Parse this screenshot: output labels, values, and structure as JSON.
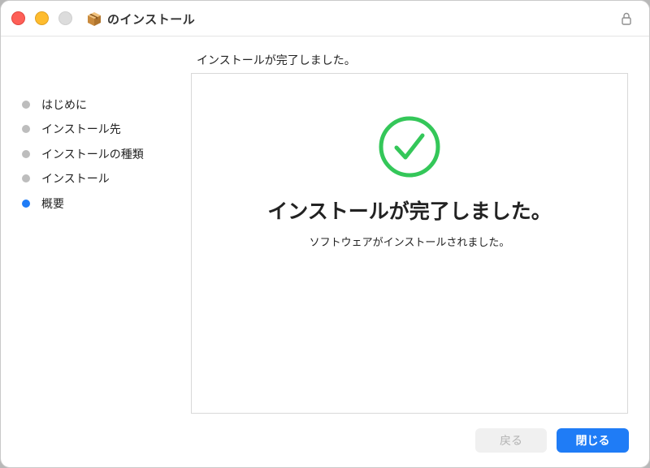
{
  "window": {
    "title": "のインストール"
  },
  "sidebar": {
    "steps": [
      {
        "label": "はじめに",
        "state": "done"
      },
      {
        "label": "インストール先",
        "state": "done"
      },
      {
        "label": "インストールの種類",
        "state": "done"
      },
      {
        "label": "インストール",
        "state": "done"
      },
      {
        "label": "概要",
        "state": "active"
      }
    ]
  },
  "content": {
    "header": "インストールが完了しました。",
    "panel_title": "インストールが完了しました。",
    "panel_subtitle": "ソフトウェアがインストールされました。",
    "status_icon": "checkmark-circle-icon"
  },
  "buttons": {
    "back_label": "戻る",
    "back_enabled": false,
    "close_label": "閉じる"
  },
  "colors": {
    "accent": "#1f7cf6",
    "success": "#34c759",
    "inactive_dot": "#bdbdbd"
  }
}
